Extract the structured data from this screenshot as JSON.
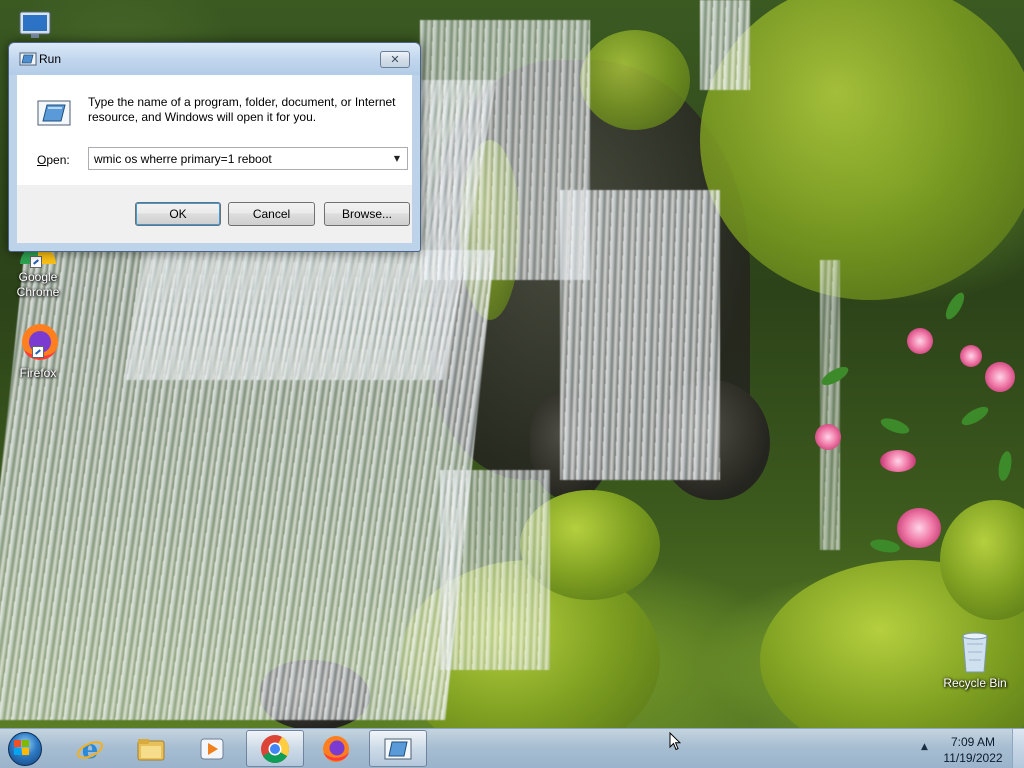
{
  "desktop": {
    "icons": [
      {
        "label": "Google Chrome",
        "icon": "chrome-icon"
      },
      {
        "label": "Firefox",
        "icon": "firefox-icon"
      },
      {
        "label": "Recycle Bin",
        "icon": "recycle-bin-icon"
      }
    ]
  },
  "run_dialog": {
    "title": "Run",
    "description": "Type the name of a program, folder, document, or Internet resource, and Windows will open it for you.",
    "open_label": "pen:",
    "open_label_accel": "O",
    "open_value": "wmic os wherre primary=1 reboot",
    "close_glyph": "✕",
    "buttons": {
      "ok": "OK",
      "cancel": "Cancel",
      "browse": "Browse..."
    }
  },
  "taskbar": {
    "pinned": [
      {
        "name": "internet-explorer-icon"
      },
      {
        "name": "file-explorer-icon"
      },
      {
        "name": "media-player-icon"
      },
      {
        "name": "chrome-icon"
      },
      {
        "name": "firefox-icon"
      },
      {
        "name": "run-icon"
      }
    ],
    "tray_arrow": "▲",
    "clock": {
      "time": "7:09 AM",
      "date": "11/19/2022"
    }
  },
  "colors": {
    "accent": "#2d7bc4",
    "taskbar": "#b2c8e1",
    "dialog_frame": "#bcd3ea"
  }
}
